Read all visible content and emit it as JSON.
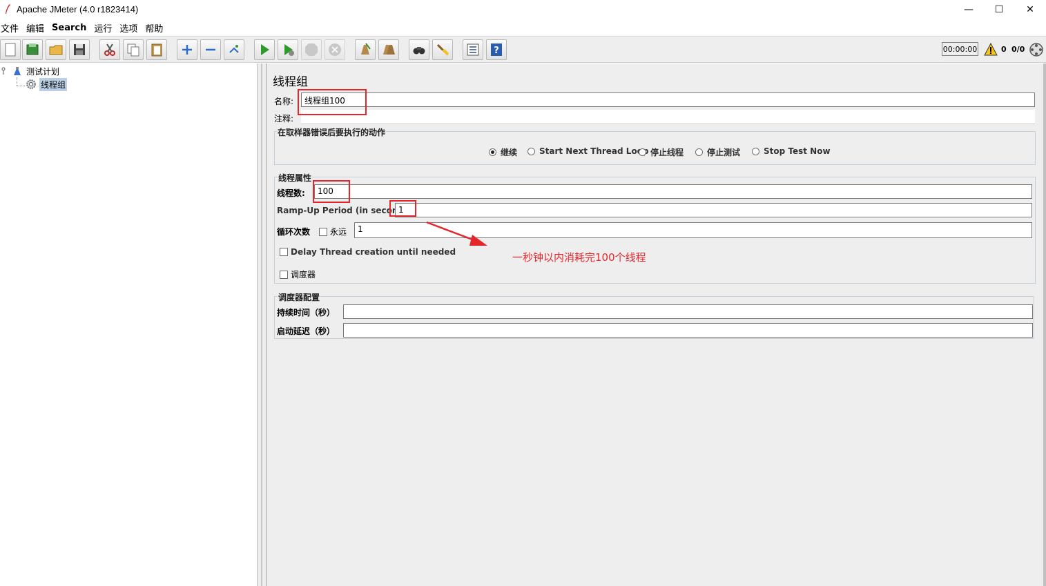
{
  "window": {
    "title": "Apache JMeter (4.0 r1823414)",
    "minimize": "—",
    "maximize": "☐",
    "close": "✕"
  },
  "menu": [
    "文件",
    "编辑",
    "Search",
    "运行",
    "选项",
    "帮助"
  ],
  "toolbar": {
    "buttons": [
      "new-icon",
      "templates-icon",
      "open-icon",
      "save-icon",
      "cut-icon",
      "copy-icon",
      "paste-icon",
      "expand-icon",
      "collapse-icon",
      "toggle-icon",
      "start-icon",
      "start-no-pause-icon",
      "stop-icon",
      "shutdown-icon",
      "clear-icon",
      "clear-all-icon",
      "search-icon",
      "reset-search-icon",
      "function-helper-icon",
      "help-icon"
    ],
    "timer": "00:00:00",
    "warning_count": "0",
    "thread_count": "0/0"
  },
  "tree": {
    "root": "测试计划",
    "child": "线程组"
  },
  "panel": {
    "title": "线程组",
    "name_label": "名称:",
    "name_value": "线程组100",
    "comment_label": "注释:",
    "comment_value": "",
    "error_action": {
      "title": "在取样器错误后要执行的动作",
      "options": [
        "继续",
        "Start Next Thread Loop",
        "停止线程",
        "停止测试",
        "Stop Test Now"
      ],
      "selected": "继续"
    },
    "thread_props": {
      "title": "线程属性",
      "threads_label": "线程数:",
      "threads_value": "100",
      "rampup_label": "Ramp-Up Period (in seconds):",
      "rampup_value": "1",
      "loop_label": "循环次数",
      "forever_label": "永远",
      "forever_checked": false,
      "loop_value": "1",
      "delay_label": "Delay Thread creation until needed",
      "delay_checked": false,
      "scheduler_label": "调度器",
      "scheduler_checked": false
    },
    "scheduler_config": {
      "title": "调度器配置",
      "duration_label": "持续时间（秒）",
      "duration_value": "",
      "delay_label": "启动延迟（秒）",
      "delay_value": ""
    }
  },
  "annotation": {
    "text": "一秒钟以内消耗完100个线程",
    "color": "#e5252a"
  }
}
